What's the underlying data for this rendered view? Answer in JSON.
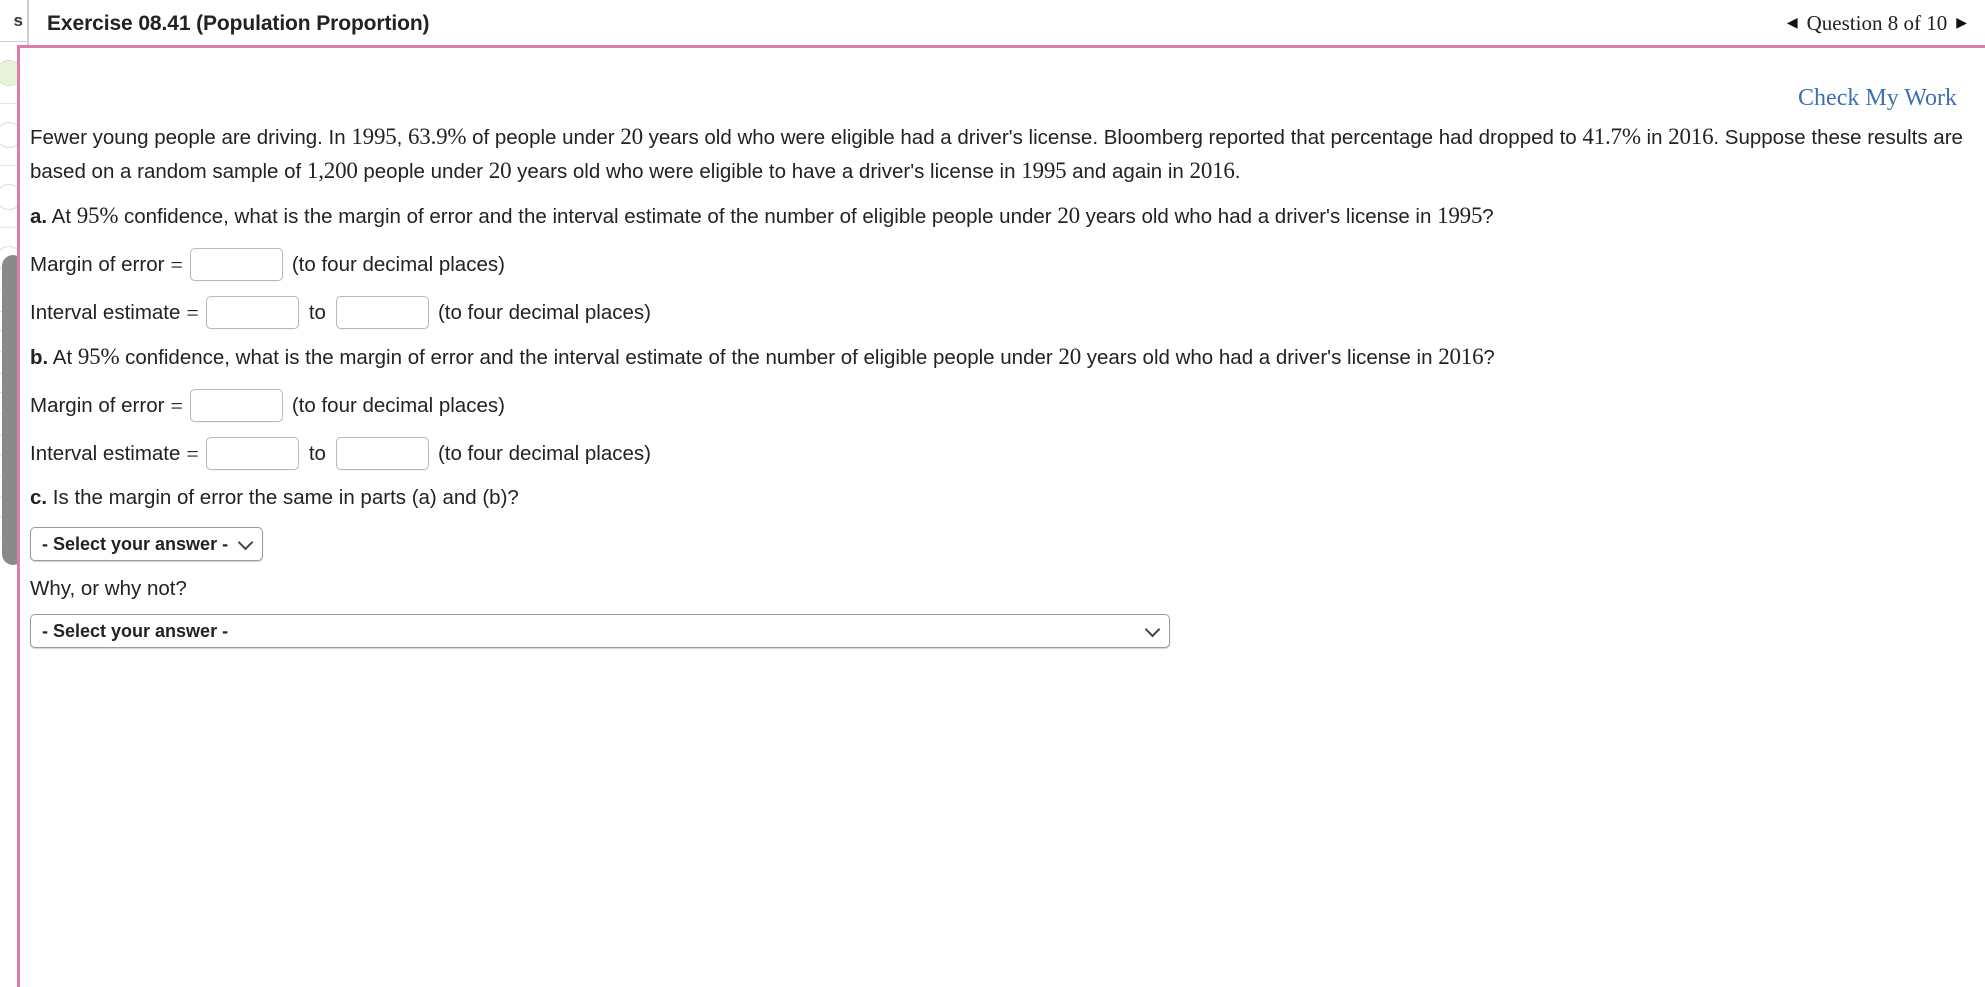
{
  "rail": {
    "partial_label": "s"
  },
  "header": {
    "title": "Exercise 08.41 (Population Proportion)",
    "prev_icon": "◀",
    "next_icon": "▶",
    "question_nav": "Question 8 of 10"
  },
  "check_my_work": "Check My Work",
  "question": {
    "stem": {
      "t1": "Fewer young people are driving. In ",
      "m1": "1995",
      "t2": ", ",
      "m2": "63.9%",
      "t3": " of people under ",
      "m3": "20",
      "t4": " years old who were eligible had a driver's license. Bloomberg reported that percentage had dropped to ",
      "m4": "41.7%",
      "t5": " in ",
      "m5": "2016",
      "t6": ". Suppose these results are based on a random sample of ",
      "m6": "1,200",
      "t7": " people under ",
      "m7": "20",
      "t8": " years old who were eligible to have a driver's license in ",
      "m8": "1995",
      "t9": " and again in ",
      "m9": "2016",
      "t10": "."
    },
    "part_a": {
      "marker": "a.",
      "t1": " At ",
      "m1": "95%",
      "t2": " confidence, what is the margin of error and the interval estimate of the number of eligible people under ",
      "m2": "20",
      "t3": " years old who had a driver's license in ",
      "m3": "1995",
      "t4": "?"
    },
    "part_b": {
      "marker": "b.",
      "t1": " At ",
      "m1": "95%",
      "t2": " confidence, what is the margin of error and the interval estimate of the number of eligible people under ",
      "m2": "20",
      "t3": " years old who had a driver's license in ",
      "m3": "2016",
      "t4": "?"
    },
    "part_c": {
      "marker": "c.",
      "text": " Is the margin of error the same in parts (a) and (b)?"
    },
    "why_label": "Why, or why not?"
  },
  "fields": {
    "margin_label": "Margin of error",
    "interval_label": "Interval estimate",
    "equals": "=",
    "to": "to",
    "hint": "(to four decimal places)",
    "a_margin_value": "",
    "a_interval_low": "",
    "a_interval_high": "",
    "b_margin_value": "",
    "b_interval_low": "",
    "b_interval_high": "",
    "placeholder": ""
  },
  "selects": {
    "part_c_answer": "- Select your answer -",
    "why_answer": "- Select your answer -"
  },
  "colors": {
    "frame_pink": "#e07aa8",
    "link_blue": "#3f6fb5",
    "text": "#222222"
  }
}
